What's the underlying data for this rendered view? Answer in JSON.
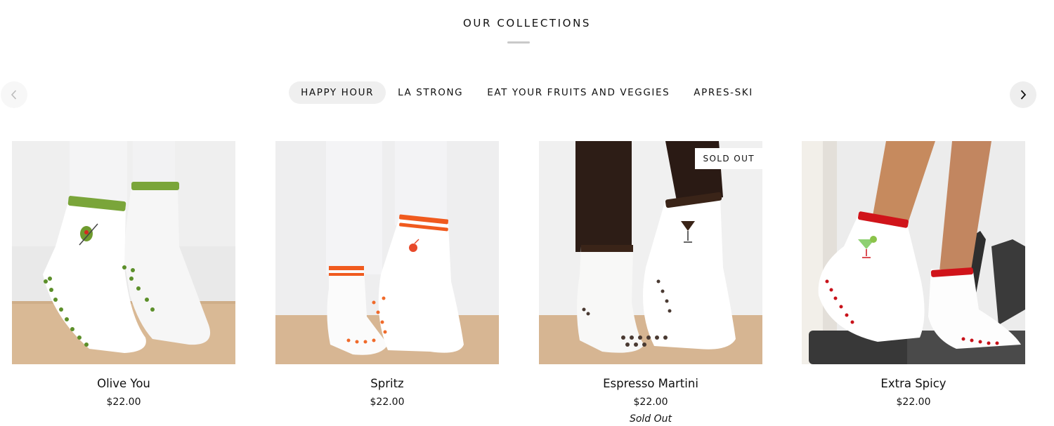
{
  "section": {
    "title": "OUR COLLECTIONS"
  },
  "tabs": [
    {
      "label": "HAPPY HOUR",
      "active": true
    },
    {
      "label": "LA STRONG",
      "active": false
    },
    {
      "label": "EAT YOUR FRUITS AND VEGGIES",
      "active": false
    },
    {
      "label": "APRES-SKI",
      "active": false
    }
  ],
  "nav": {
    "prev_icon": "chevron-left-icon",
    "next_icon": "chevron-right-icon"
  },
  "products": [
    {
      "name": "Olive You",
      "price": "$22.00",
      "accent": "#7aa53a",
      "icon": "olive-icon"
    },
    {
      "name": "Spritz",
      "price": "$22.00",
      "accent": "#f05a1e",
      "icon": "spritz-glass-icon"
    },
    {
      "name": "Espresso Martini",
      "price": "$22.00",
      "badge": "SOLD OUT",
      "status": "Sold Out",
      "accent": "#3b2418",
      "icon": "martini-glass-icon"
    },
    {
      "name": "Extra Spicy",
      "price": "$22.00",
      "accent": "#d0141a",
      "icon": "margarita-glass-icon"
    }
  ]
}
